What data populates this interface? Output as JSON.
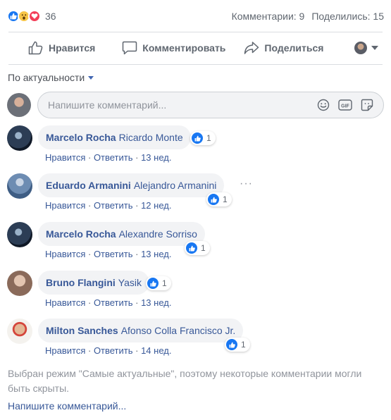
{
  "stats": {
    "reactions": [
      "like-icon",
      "wow-icon",
      "love-icon"
    ],
    "reaction_count": "36",
    "comments_label": "Комментарии: 9",
    "shares_label": "Поделились: 15"
  },
  "actions": {
    "like_label": "Нравится",
    "comment_label": "Комментировать",
    "share_label": "Поделиться"
  },
  "sort": {
    "label": "По актуальности"
  },
  "composer": {
    "placeholder": "Напишите комментарий..."
  },
  "comments": [
    {
      "author": "Marcelo Rocha",
      "mention": "Ricardo Monte",
      "likes": "1",
      "like_action": "Нравится",
      "reply_action": "Ответить",
      "time": "13 нед."
    },
    {
      "author": "Eduardo Armanini",
      "mention": "Alejandro Armanini",
      "likes": "1",
      "like_action": "Нравится",
      "reply_action": "Ответить",
      "time": "12 нед."
    },
    {
      "author": "Marcelo Rocha",
      "mention": "Alexandre Sorriso",
      "likes": "1",
      "like_action": "Нравится",
      "reply_action": "Ответить",
      "time": "13 нед."
    },
    {
      "author": "Bruno Flangini",
      "mention": "Yasik",
      "likes": "1",
      "like_action": "Нравится",
      "reply_action": "Ответить",
      "time": "13 нед."
    },
    {
      "author": "Milton Sanches",
      "mention": "Afonso Colla Francisco Jr.",
      "likes": "1",
      "like_action": "Нравится",
      "reply_action": "Ответить",
      "time": "14 нед."
    }
  ],
  "notice": "Выбран режим \"Самые актуальные\", поэтому некоторые комментарии могли быть скрыты.",
  "write_comment_link": "Напишите комментарий...",
  "colors": {
    "link": "#385898",
    "like_blue": "#1877f2",
    "bubble": "#f2f3f5",
    "love": "#f33e58",
    "wow": "#f7c547"
  }
}
